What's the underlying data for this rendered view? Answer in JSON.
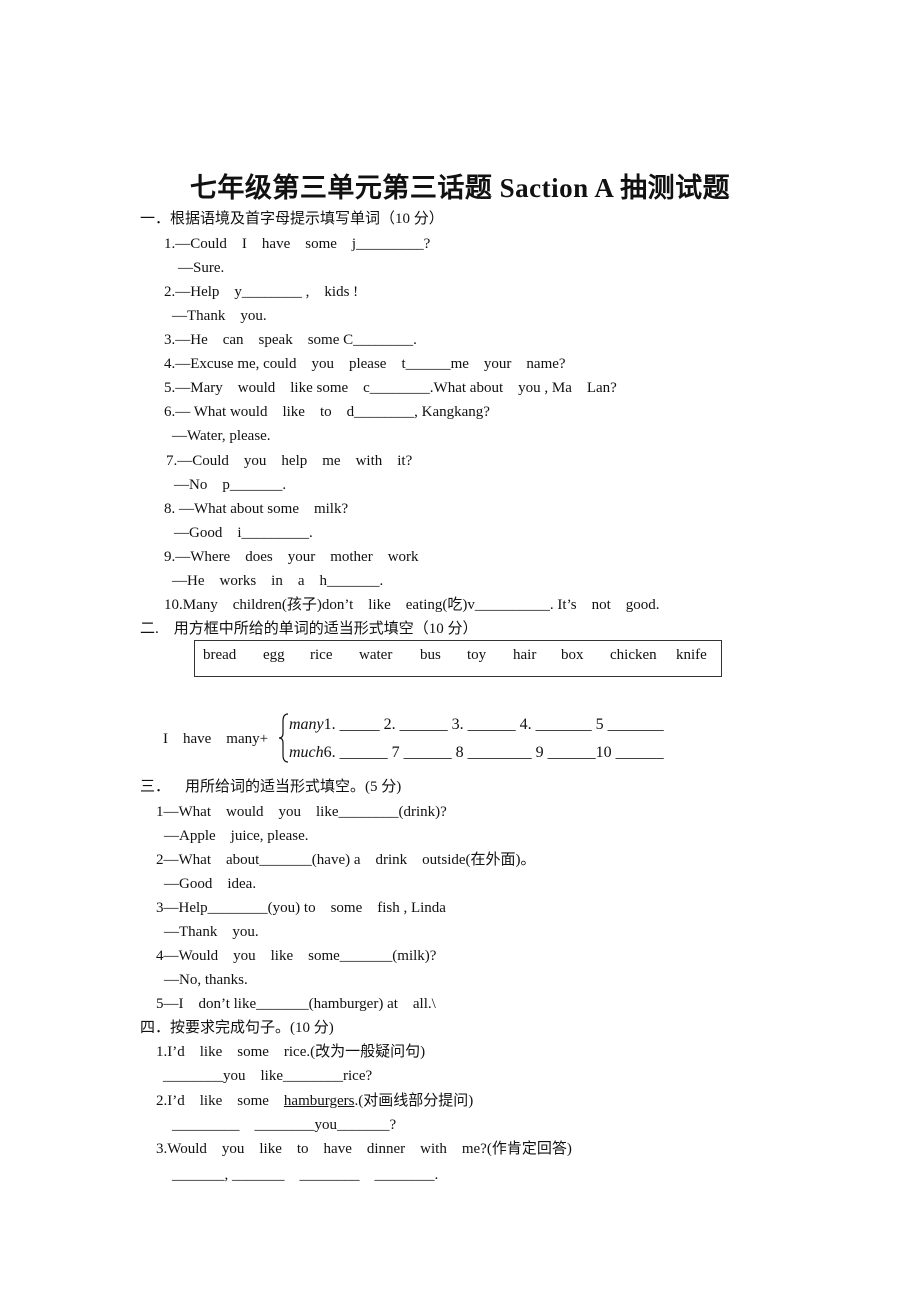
{
  "title": "七年级第三单元第三话题 Saction A  抽测试题",
  "section1": {
    "heading": "一．根据语境及首字母提示填写单词（10 分）",
    "lines": [
      "1.—Could    I    have    some    j_________?",
      "—Sure.",
      "2.—Help    y________ ,    kids !",
      "—Thank    you.",
      "3.—He    can    speak    some C________.",
      "4.—Excuse me, could    you    please    t______me    your    name?",
      "5.—Mary    would    like some    c________.What about    you , Ma    Lan?",
      "6.— What would    like    to    d________, Kangkang?",
      "—Water, please.",
      "7.—Could    you    help    me    with    it?",
      "—No    p_______.",
      "8. —What about some    milk?",
      "—Good    i_________.",
      "9.—Where    does    your    mother    work",
      "—He    works    in    a    h_______.",
      "10.Many    children(孩子)don’t    like    eating(吃)v__________. It’s    not    good."
    ]
  },
  "section2": {
    "heading": "二.    用方框中所给的单词的适当形式填空（10 分）",
    "words": [
      "bread",
      "egg",
      "rice",
      "water",
      "bus",
      "toy",
      "hair",
      "box",
      "chicken",
      "knife"
    ],
    "prefix": "I    have    many+",
    "row1_label": "many",
    "row1": "1. _____ 2. ______ 3. ______ 4. _______ 5 _______",
    "row2_label": "much",
    "row2": "6. ______ 7 ______ 8 ________ 9 ______10 ______"
  },
  "section3": {
    "heading": "三．    用所给词的适当形式填空。(5 分)",
    "lines": [
      "1—What    would    you    like________(drink)?",
      "—Apple    juice, please.",
      "2—What    about_______(have) a    drink    outside(在外面)。",
      "—Good    idea.",
      "3—Help________(you) to    some    fish , Linda",
      "—Thank    you.",
      "4—Would    you    like    some_______(milk)?",
      "—No, thanks.",
      "5—I    don’t like_______(hamburger) at    all.\\"
    ]
  },
  "section4": {
    "heading": "四．按要求完成句子。(10 分)",
    "q1": "1.I’d    like    some    rice.(改为一般疑问句)",
    "a1": "________you    like________rice?",
    "q2_pre": "2.I’d    like    some    ",
    "q2_underlined": "hamburgers",
    "q2_post": ".(对画线部分提问)",
    "a2": "_________    ________you_______?",
    "q3": "3.Would    you    like    to    have    dinner    with    me?(作肯定回答)",
    "a3": "_______, _______    ________    ________."
  }
}
